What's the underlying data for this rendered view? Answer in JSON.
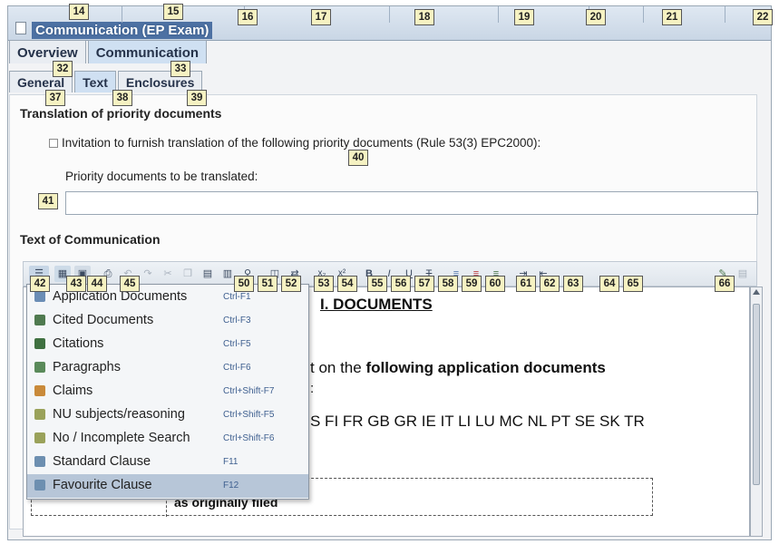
{
  "window": {
    "title": "Communication (EP Exam)"
  },
  "tabs_top": [
    {
      "label": "Overview"
    },
    {
      "label": "Communication"
    }
  ],
  "tabs_sub": [
    {
      "label": "General"
    },
    {
      "label": "Text"
    },
    {
      "label": "Enclosures"
    }
  ],
  "translation": {
    "heading": "Translation of priority documents",
    "checkbox_label": "Invitation to furnish translation of the following priority documents (Rule 53(3) EPC2000):",
    "field_label": "Priority documents to be translated:",
    "field_value": ""
  },
  "communication": {
    "heading": "Text of Communication"
  },
  "editor": {
    "doc_heading": "I. DOCUMENTS",
    "line1_prefix": "t on the ",
    "line1_bold": "following application documents",
    "line2": ":",
    "line3": "S FI FR GB GR IE IT LI LU MC NL PT SE SK TR",
    "line4": "as originally filed"
  },
  "menu": {
    "items": [
      {
        "label": "Application Documents",
        "shortcut": "Ctrl-F1",
        "icon": "application-documents-icon",
        "color": "#6b8db5"
      },
      {
        "label": "Cited Documents",
        "shortcut": "Ctrl-F3",
        "icon": "cited-documents-icon",
        "color": "#4f7a4f"
      },
      {
        "label": "Citations",
        "shortcut": "Ctrl-F5",
        "icon": "citations-icon",
        "color": "#3f7040"
      },
      {
        "label": "Paragraphs",
        "shortcut": "Ctrl-F6",
        "icon": "paragraphs-icon",
        "color": "#5a8a5a"
      },
      {
        "label": "Claims",
        "shortcut": "Ctrl+Shift-F7",
        "icon": "claims-icon",
        "color": "#c98a3a"
      },
      {
        "label": "NU subjects/reasoning",
        "shortcut": "Ctrl+Shift-F5",
        "icon": "nu-subjects-icon",
        "color": "#9aa25a"
      },
      {
        "label": "No / Incomplete Search",
        "shortcut": "Ctrl+Shift-F6",
        "icon": "incomplete-search-icon",
        "color": "#9aa25a"
      },
      {
        "label": "Standard Clause",
        "shortcut": "F11",
        "icon": "standard-clause-icon",
        "color": "#6d8fb0"
      },
      {
        "label": "Favourite Clause",
        "shortcut": "F12",
        "icon": "favourite-clause-icon",
        "color": "#6d8fb0"
      }
    ],
    "highlighted_index": 8
  },
  "badges": [
    "14",
    "15",
    "16",
    "17",
    "18",
    "19",
    "20",
    "21",
    "22",
    "32",
    "33",
    "37",
    "38",
    "39",
    "40",
    "41",
    "42",
    "43",
    "44",
    "45",
    "50",
    "51",
    "52",
    "53",
    "54",
    "55",
    "56",
    "57",
    "58",
    "59",
    "60",
    "61",
    "62",
    "63",
    "64",
    "65",
    "66"
  ]
}
